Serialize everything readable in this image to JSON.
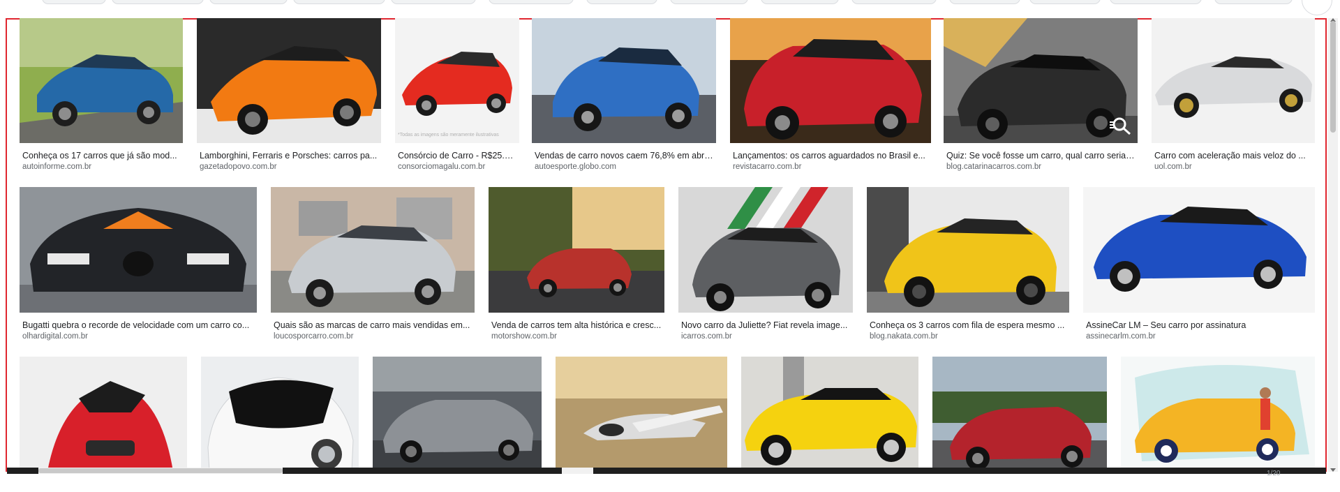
{
  "results": {
    "rows": [
      [
        {
          "title": "Conheça os 17 carros que já são mod...",
          "source": "autoinforme.com.br",
          "img": "blue-suv-hills"
        },
        {
          "title": "Lamborghini, Ferraris e Porsches: carros pa...",
          "source": "gazetadopovo.com.br",
          "img": "orange-supercar"
        },
        {
          "title": "Consórcio de Carro - R$25.0...",
          "source": "consorciomagalu.com.br",
          "img": "red-hatchback",
          "watermark": "*Todas as imagens são meramente ilustrativas"
        },
        {
          "title": "Vendas de carro novos caem 76,8% em abri...",
          "source": "autoesporte.globo.com",
          "img": "blue-suv-sky"
        },
        {
          "title": "Lançamentos: os carros aguardados no Brasil e...",
          "source": "revistacarro.com.br",
          "img": "red-fiat-suv"
        },
        {
          "title": "Quiz: Se você fosse um carro, qual carro seria?...",
          "source": "blog.catarinacarros.com.br",
          "img": "black-hypercar"
        },
        {
          "title": "Carro com aceleração mais veloz do ...",
          "source": "uol.com.br",
          "img": "white-hypercar"
        }
      ],
      [
        {
          "title": "Bugatti quebra o recorde de velocidade com um carro co...",
          "source": "olhardigital.com.br",
          "img": "bugatti-black"
        },
        {
          "title": "Quais são as marcas de carro mais vendidas em...",
          "source": "loucosporcarro.com.br",
          "img": "silver-onix"
        },
        {
          "title": "Venda de carros tem alta histórica e cresc...",
          "source": "motorshow.com.br",
          "img": "red-hatch-forest"
        },
        {
          "title": "Novo carro da Juliette? Fiat revela image...",
          "source": "icarros.com.br",
          "img": "gray-fiat-italy"
        },
        {
          "title": "Conheça os 3 carros com fila de espera mesmo ...",
          "source": "blog.nakata.com.br",
          "img": "yellow-urus"
        },
        {
          "title": "AssineCar LM – Seu carro por assinatura",
          "source": "assinecarlm.com.br",
          "img": "blue-fiat-hatch"
        }
      ],
      [
        {
          "img": "red-concept"
        },
        {
          "img": "white-icar-concept"
        },
        {
          "img": "gray-coupe-suv"
        },
        {
          "img": "flying-car"
        },
        {
          "img": "yellow-camaro"
        },
        {
          "img": "red-peugeot-suv"
        },
        {
          "img": "yellow-cartoon-car"
        }
      ]
    ]
  },
  "pager": {
    "count": "1/20"
  },
  "colors": {
    "frame": "#e0262f",
    "title": "#202124",
    "source": "#5f6368"
  },
  "icons": {
    "lens": "google-lens-icon"
  }
}
